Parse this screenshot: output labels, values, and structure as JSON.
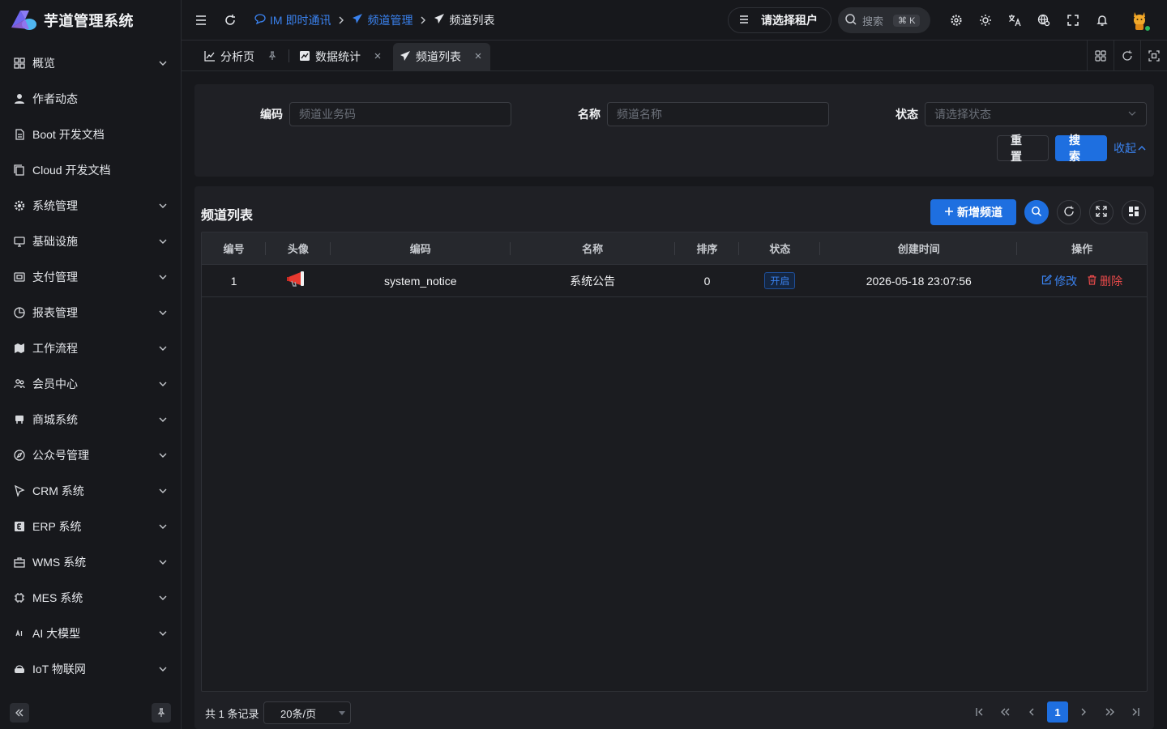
{
  "app": {
    "title": "芋道管理系统"
  },
  "sidebar": {
    "items": [
      {
        "label": "概览",
        "icon": "dashboard-icon",
        "expandable": true
      },
      {
        "label": "作者动态",
        "icon": "user-icon",
        "expandable": false
      },
      {
        "label": "Boot 开发文档",
        "icon": "document-icon",
        "expandable": false
      },
      {
        "label": "Cloud 开发文档",
        "icon": "copy-document-icon",
        "expandable": false
      },
      {
        "label": "系统管理",
        "icon": "gear-icon",
        "expandable": true
      },
      {
        "label": "基础设施",
        "icon": "monitor-icon",
        "expandable": true
      },
      {
        "label": "支付管理",
        "icon": "payment-icon",
        "expandable": true
      },
      {
        "label": "报表管理",
        "icon": "pie-chart-icon",
        "expandable": true
      },
      {
        "label": "工作流程",
        "icon": "workflow-icon",
        "expandable": true
      },
      {
        "label": "会员中心",
        "icon": "members-icon",
        "expandable": true
      },
      {
        "label": "商城系统",
        "icon": "shop-icon",
        "expandable": true
      },
      {
        "label": "公众号管理",
        "icon": "compass-icon",
        "expandable": true
      },
      {
        "label": "CRM 系统",
        "icon": "crm-icon",
        "expandable": true
      },
      {
        "label": "ERP 系统",
        "icon": "erp-icon",
        "expandable": true
      },
      {
        "label": "WMS 系统",
        "icon": "warehouse-icon",
        "expandable": true
      },
      {
        "label": "MES 系统",
        "icon": "chip-icon",
        "expandable": true
      },
      {
        "label": "AI 大模型",
        "icon": "ai-icon",
        "expandable": true
      },
      {
        "label": "IoT 物联网",
        "icon": "router-icon",
        "expandable": true
      }
    ]
  },
  "header": {
    "breadcrumb": [
      {
        "label": "IM 即时通讯",
        "icon": "chat-icon"
      },
      {
        "label": "频道管理",
        "icon": "send-icon"
      },
      {
        "label": "频道列表",
        "icon": "send-icon"
      }
    ],
    "tenant_placeholder": "请选择租户",
    "search_label": "搜索",
    "search_shortcut": "⌘ K"
  },
  "tabs": [
    {
      "label": "分析页",
      "icon": "chart-icon",
      "pinned": true,
      "active": false
    },
    {
      "label": "数据统计",
      "icon": "stats-icon",
      "pinned": false,
      "active": false
    },
    {
      "label": "频道列表",
      "icon": "send-icon",
      "pinned": false,
      "active": true
    }
  ],
  "search_form": {
    "code_label": "编码",
    "code_placeholder": "频道业务码",
    "name_label": "名称",
    "name_placeholder": "频道名称",
    "status_label": "状态",
    "status_placeholder": "请选择状态",
    "reset_label": "重置",
    "search_label": "搜索",
    "collapse_label": "收起"
  },
  "table": {
    "title": "频道列表",
    "add_label": "新增频道",
    "columns": [
      "编号",
      "头像",
      "编码",
      "名称",
      "排序",
      "状态",
      "创建时间",
      "操作"
    ],
    "rows": [
      {
        "id": "1",
        "avatar": "megaphone",
        "code": "system_notice",
        "name": "系统公告",
        "sort": "0",
        "status": "开启",
        "created": "2026-05-18 23:07:56",
        "edit": "修改",
        "delete": "删除"
      }
    ]
  },
  "pagination": {
    "total_text": "共 1 条记录",
    "page_size": "20条/页",
    "current_page": "1"
  },
  "colors": {
    "primary": "#1e6fe0",
    "link": "#3a82ef",
    "danger": "#e84a4a",
    "background": "#17181c",
    "panel": "#1f2025"
  }
}
